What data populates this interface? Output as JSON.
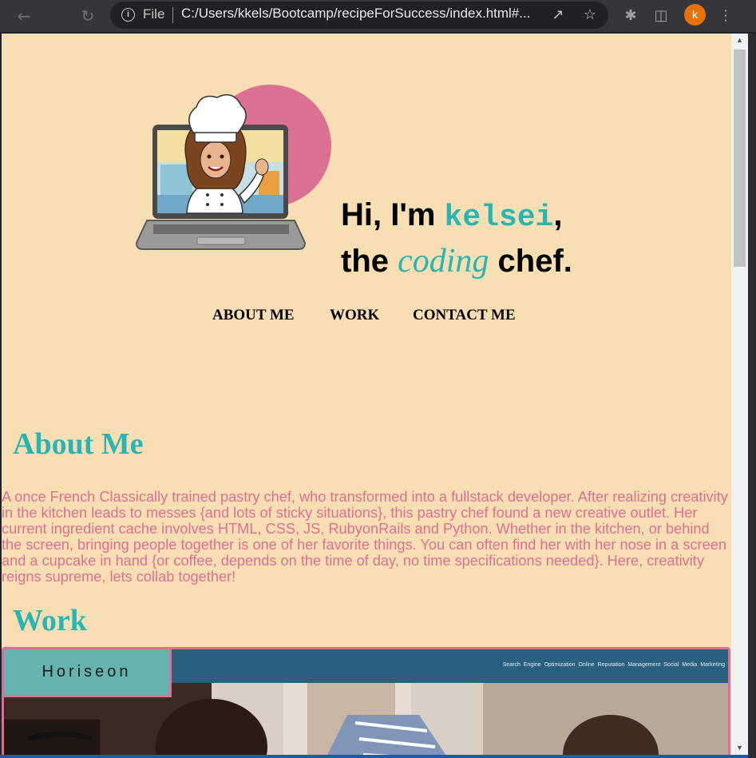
{
  "browser": {
    "file_label": "File",
    "url": "C:/Users/kkels/Bootcamp/recipeForSuccess/index.html#...",
    "profile_initial": "k",
    "icons": [
      "back-icon",
      "reload-icon",
      "info-icon",
      "share-icon",
      "star-icon",
      "extensions-icon",
      "sidebar-icon",
      "menu-icon"
    ],
    "profile_color": "#e8710a"
  },
  "hero": {
    "line1_prefix": "Hi, I'm ",
    "name": "kelsei",
    "line1_suffix": ",",
    "line2_prefix": "the ",
    "coding": "coding",
    "line2_suffix": " chef.",
    "accent": "#2ab5b5",
    "circle_color": "#db7093"
  },
  "nav": {
    "items": [
      {
        "label": "ABOUT ME"
      },
      {
        "label": "WORK"
      },
      {
        "label": "CONTACT ME"
      }
    ]
  },
  "about": {
    "heading": "About Me",
    "text": "A once French Classically trained pastry chef, who transformed into a fullstack developer. After realizing creativity in the kitchen leads to messes {and lots of sticky situations}, this pastry chef found a new creative outlet. Her current ingredient cache involves HTML, CSS, JS, RubyonRails and Python. Whether in the kitchen, or behind the screen, bringing people together is one of her favorite things. You can often find her with her nose in a screen and a cupcake in hand {or coffee, depends on the time of day, no time specifications needed}. Here, creativity reigns supreme, lets collab together!"
  },
  "work": {
    "heading": "Work",
    "project_label": "Horiseon",
    "preview_links": "Search Engine Optimization   Online Reputation Management   Social Media Marketing"
  },
  "colors": {
    "page_bg": "#f7deb3",
    "heading": "#2ab5b5",
    "body_text": "#db7093"
  }
}
